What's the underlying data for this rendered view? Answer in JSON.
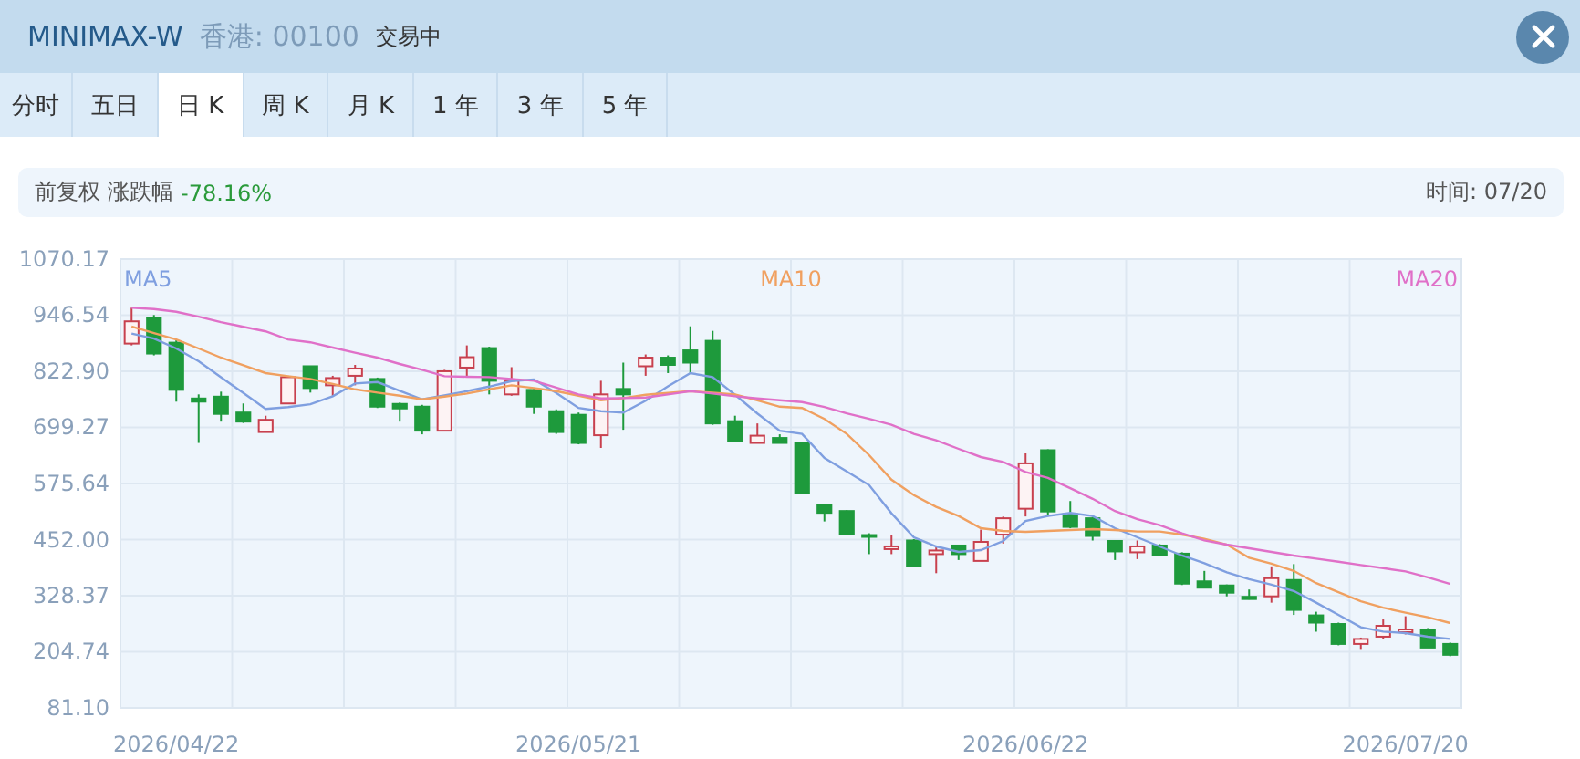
{
  "header": {
    "title": "MINIMAX-W",
    "market": "香港: 00100",
    "status": "交易中"
  },
  "tabs": [
    {
      "label": "分时",
      "selected": false
    },
    {
      "label": "五日",
      "selected": false
    },
    {
      "label": "日 K",
      "selected": true
    },
    {
      "label": "周 K",
      "selected": false
    },
    {
      "label": "月 K",
      "selected": false
    },
    {
      "label": "1 年",
      "selected": false
    },
    {
      "label": "3 年",
      "selected": false
    },
    {
      "label": "5 年",
      "selected": false
    }
  ],
  "info": {
    "adjustment": "前复权",
    "change_label": "涨跌幅",
    "change": "-78.16%",
    "time": "时间: 07/20"
  },
  "chart": {
    "chart_data": {
      "type": "candlestick",
      "grid": true,
      "categories": [
        null,
        null,
        "2026/04/22",
        null,
        null,
        null,
        null,
        null,
        null,
        null,
        null,
        null,
        null,
        null,
        null,
        null,
        null,
        null,
        null,
        null,
        "2026/05/21",
        null,
        null,
        null,
        null,
        null,
        null,
        null,
        null,
        null,
        null,
        null,
        null,
        null,
        null,
        null,
        null,
        null,
        null,
        null,
        "2026/06/22",
        null,
        null,
        null,
        null,
        null,
        null,
        null,
        null,
        null,
        null,
        null,
        null,
        null,
        null,
        null,
        null,
        "2026/07/20",
        null,
        null
      ],
      "ylim": [
        81.1,
        1070.17
      ],
      "yticks": [
        {
          "value": 1070.17,
          "label": "1070.17"
        },
        {
          "value": 946.54,
          "label": "946.54"
        },
        {
          "value": 822.9,
          "label": "822.90"
        },
        {
          "value": 699.27,
          "label": "699.27"
        },
        {
          "value": 575.64,
          "label": "575.64"
        },
        {
          "value": 452.0,
          "label": "452.00"
        },
        {
          "value": 328.37,
          "label": "328.37"
        },
        {
          "value": 204.74,
          "label": "204.74"
        },
        {
          "value": 81.1,
          "label": "81.10"
        }
      ],
      "series": [
        {
          "name": "MA5",
          "type": "line",
          "color": "#7f9fe0",
          "values": [
            906,
            895,
            873,
            845,
            810,
            775,
            740,
            744,
            750,
            768,
            796,
            799,
            780,
            761,
            770,
            779,
            789,
            801,
            805,
            775,
            742,
            735,
            732,
            758,
            790,
            819,
            810,
            771,
            730,
            692,
            685,
            632,
            602,
            572,
            510,
            457,
            437,
            425,
            429,
            449,
            493,
            504,
            511,
            504,
            477,
            457,
            437,
            417,
            400,
            380,
            365,
            353,
            339,
            313,
            286,
            259,
            249,
            246,
            238,
            233
          ]
        },
        {
          "name": "MA10",
          "type": "line",
          "color": "#f0a060",
          "values": [
            922,
            907,
            893,
            873,
            853,
            836,
            819,
            812,
            806,
            795,
            783,
            776,
            769,
            761,
            767,
            774,
            783,
            792,
            786,
            779,
            769,
            759,
            764,
            771,
            775,
            779,
            776,
            772,
            759,
            745,
            742,
            718,
            685,
            638,
            584,
            550,
            524,
            504,
            477,
            471,
            469,
            471,
            473,
            475,
            473,
            470,
            470,
            463,
            454,
            441,
            412,
            399,
            383,
            356,
            336,
            316,
            302,
            291,
            281,
            268
          ]
        },
        {
          "name": "MA20",
          "type": "line",
          "color": "#e070c8",
          "values": [
            963,
            960,
            954,
            943,
            931,
            921,
            911,
            893,
            887,
            875,
            864,
            853,
            839,
            826,
            812,
            811,
            810,
            806,
            802,
            787,
            772,
            763,
            764,
            765,
            772,
            779,
            774,
            768,
            763,
            759,
            755,
            744,
            730,
            718,
            705,
            685,
            671,
            652,
            634,
            623,
            601,
            588,
            565,
            542,
            515,
            497,
            484,
            466,
            450,
            441,
            433,
            425,
            417,
            410,
            403,
            396,
            389,
            382,
            369,
            354
          ]
        }
      ],
      "ohlc": [
        [
          884,
          963,
          880,
          933
        ],
        [
          940,
          947,
          858,
          862
        ],
        [
          886,
          893,
          756,
          782
        ],
        [
          763,
          772,
          665,
          756
        ],
        [
          767,
          778,
          712,
          729
        ],
        [
          732,
          752,
          709,
          712
        ],
        [
          689,
          725,
          689,
          716
        ],
        [
          752,
          813,
          752,
          810
        ],
        [
          834,
          834,
          776,
          786
        ],
        [
          792,
          813,
          769,
          808
        ],
        [
          813,
          837,
          792,
          829
        ],
        [
          806,
          809,
          742,
          745
        ],
        [
          751,
          754,
          712,
          741
        ],
        [
          745,
          749,
          684,
          692
        ],
        [
          692,
          826,
          692,
          823
        ],
        [
          831,
          880,
          810,
          854
        ],
        [
          874,
          877,
          772,
          802
        ],
        [
          772,
          832,
          769,
          803
        ],
        [
          782,
          786,
          729,
          745
        ],
        [
          735,
          739,
          685,
          689
        ],
        [
          727,
          732,
          662,
          665
        ],
        [
          682,
          802,
          654,
          772
        ],
        [
          784,
          842,
          694,
          772
        ],
        [
          834,
          860,
          813,
          853
        ],
        [
          853,
          858,
          819,
          837
        ],
        [
          869,
          922,
          818,
          842
        ],
        [
          890,
          912,
          705,
          708
        ],
        [
          713,
          725,
          667,
          670
        ],
        [
          665,
          708,
          665,
          681
        ],
        [
          676,
          684,
          665,
          665
        ],
        [
          665,
          668,
          552,
          555
        ],
        [
          528,
          530,
          492,
          511
        ],
        [
          515,
          517,
          461,
          464
        ],
        [
          462,
          466,
          420,
          458
        ],
        [
          431,
          461,
          420,
          437
        ],
        [
          450,
          453,
          393,
          393
        ],
        [
          420,
          436,
          378,
          428
        ],
        [
          439,
          441,
          407,
          420
        ],
        [
          405,
          474,
          405,
          447
        ],
        [
          463,
          503,
          443,
          499
        ],
        [
          520,
          642,
          503,
          620
        ],
        [
          649,
          651,
          503,
          514
        ],
        [
          508,
          537,
          477,
          480
        ],
        [
          499,
          502,
          450,
          460
        ],
        [
          449,
          451,
          407,
          426
        ],
        [
          424,
          450,
          409,
          437
        ],
        [
          439,
          442,
          415,
          417
        ],
        [
          421,
          424,
          352,
          355
        ],
        [
          360,
          383,
          345,
          346
        ],
        [
          351,
          353,
          327,
          335
        ],
        [
          326,
          342,
          320,
          321
        ],
        [
          327,
          393,
          313,
          367
        ],
        [
          363,
          398,
          286,
          297
        ],
        [
          285,
          293,
          249,
          269
        ],
        [
          266,
          269,
          219,
          222
        ],
        [
          222,
          236,
          211,
          233
        ],
        [
          238,
          276,
          233,
          262
        ],
        [
          248,
          283,
          243,
          254
        ],
        [
          254,
          257,
          214,
          214
        ],
        [
          222,
          225,
          195,
          198
        ]
      ]
    }
  }
}
